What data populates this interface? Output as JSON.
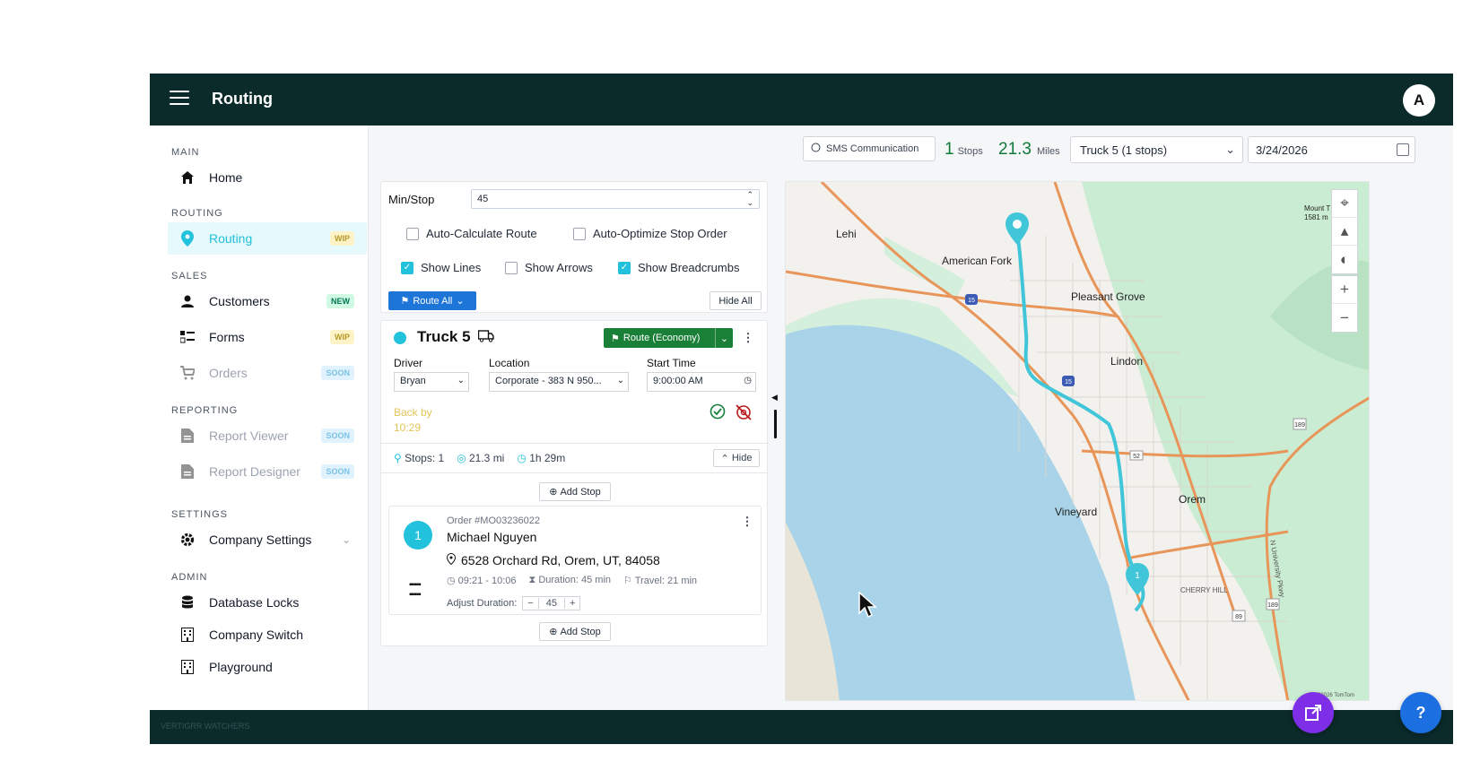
{
  "topbar": {
    "title": "Routing",
    "avatar_initial": "A"
  },
  "sidebar": {
    "sections": {
      "main": "MAIN",
      "routing": "ROUTING",
      "sales": "SALES",
      "reporting": "REPORTING",
      "settings": "SETTINGS",
      "admin": "ADMIN"
    },
    "items": {
      "home": {
        "label": "Home",
        "icon": "home-icon"
      },
      "routing": {
        "label": "Routing",
        "badge": "WIP",
        "icon": "map-pin-icon"
      },
      "customers": {
        "label": "Customers",
        "badge": "NEW",
        "icon": "person-icon"
      },
      "forms": {
        "label": "Forms",
        "badge": "WIP",
        "icon": "forms-icon"
      },
      "orders": {
        "label": "Orders",
        "badge": "SOON",
        "icon": "cart-icon"
      },
      "report_viewer": {
        "label": "Report Viewer",
        "badge": "SOON",
        "icon": "report-icon"
      },
      "report_designer": {
        "label": "Report Designer",
        "badge": "SOON",
        "icon": "report-icon"
      },
      "company_settings": {
        "label": "Company Settings",
        "icon": "gear-icon"
      },
      "database_locks": {
        "label": "Database Locks",
        "icon": "database-icon"
      },
      "company_switch": {
        "label": "Company Switch",
        "icon": "building-icon"
      },
      "playground": {
        "label": "Playground",
        "icon": "building-icon"
      }
    }
  },
  "footer": {
    "text": "VERTIGRR WATCHERS"
  },
  "header": {
    "sms_label": "SMS Communication",
    "stops_count": "1",
    "stops_label": "Stops",
    "miles_value": "21.3",
    "miles_label": "Miles",
    "truck_select_value": "Truck 5 (1 stops)",
    "date_value": "3/24/2026"
  },
  "settings": {
    "min_stop_label": "Min/Stop",
    "min_stop_value": "45",
    "auto_calc_label": "Auto-Calculate Route",
    "auto_calc_checked": false,
    "auto_opt_label": "Auto-Optimize Stop Order",
    "auto_opt_checked": false,
    "show_lines_label": "Show Lines",
    "show_lines_checked": true,
    "show_arrows_label": "Show Arrows",
    "show_arrows_checked": false,
    "show_breadcrumbs_label": "Show Breadcrumbs",
    "show_breadcrumbs_checked": true,
    "route_all_label": "Route All",
    "hide_all_label": "Hide All"
  },
  "truck": {
    "name": "Truck 5",
    "route_button": "Route (Economy)",
    "driver_label": "Driver",
    "driver_value": "Bryan",
    "location_label": "Location",
    "location_value": "Corporate - 383 N 950...",
    "start_label": "Start Time",
    "start_value": "9:00:00 AM",
    "back_by_label": "Back by",
    "back_by_value": "10:29",
    "stops_stat": "Stops: 1",
    "distance_stat": "21.3 mi",
    "duration_stat": "1h 29m",
    "hide_label": "Hide",
    "add_stop_label": "Add Stop",
    "accent": "#22c1dc"
  },
  "stop": {
    "number": "1",
    "order_no": "Order #MO03236022",
    "customer": "Michael Nguyen",
    "address": "6528 Orchard Rd, Orem, UT, 84058",
    "time_window": "09:21 - 10:06",
    "duration": "Duration: 45 min",
    "travel": "Travel: 21 min",
    "adjust_label": "Adjust Duration:",
    "adjust_value": "45"
  },
  "map": {
    "labels": {
      "lehi": "Lehi",
      "american_fork": "American Fork",
      "pleasant_grove": "Pleasant Grove",
      "lindon": "Lindon",
      "vineyard": "Vineyard",
      "orem": "Orem",
      "cherry_hill": "CHERRY HILL",
      "mount": "Mount T",
      "mount_elev": "1581 m",
      "university": "N University Pkwy",
      "copyright": "©2026 TomTom"
    },
    "shields": [
      "15",
      "15",
      "52",
      "189",
      "189",
      "89"
    ],
    "colors": {
      "water": "#a9d3e8",
      "park": "#c9ecd2",
      "land": "#f3f1ed",
      "route": "#41c6d9",
      "road": "#e8955a"
    }
  }
}
